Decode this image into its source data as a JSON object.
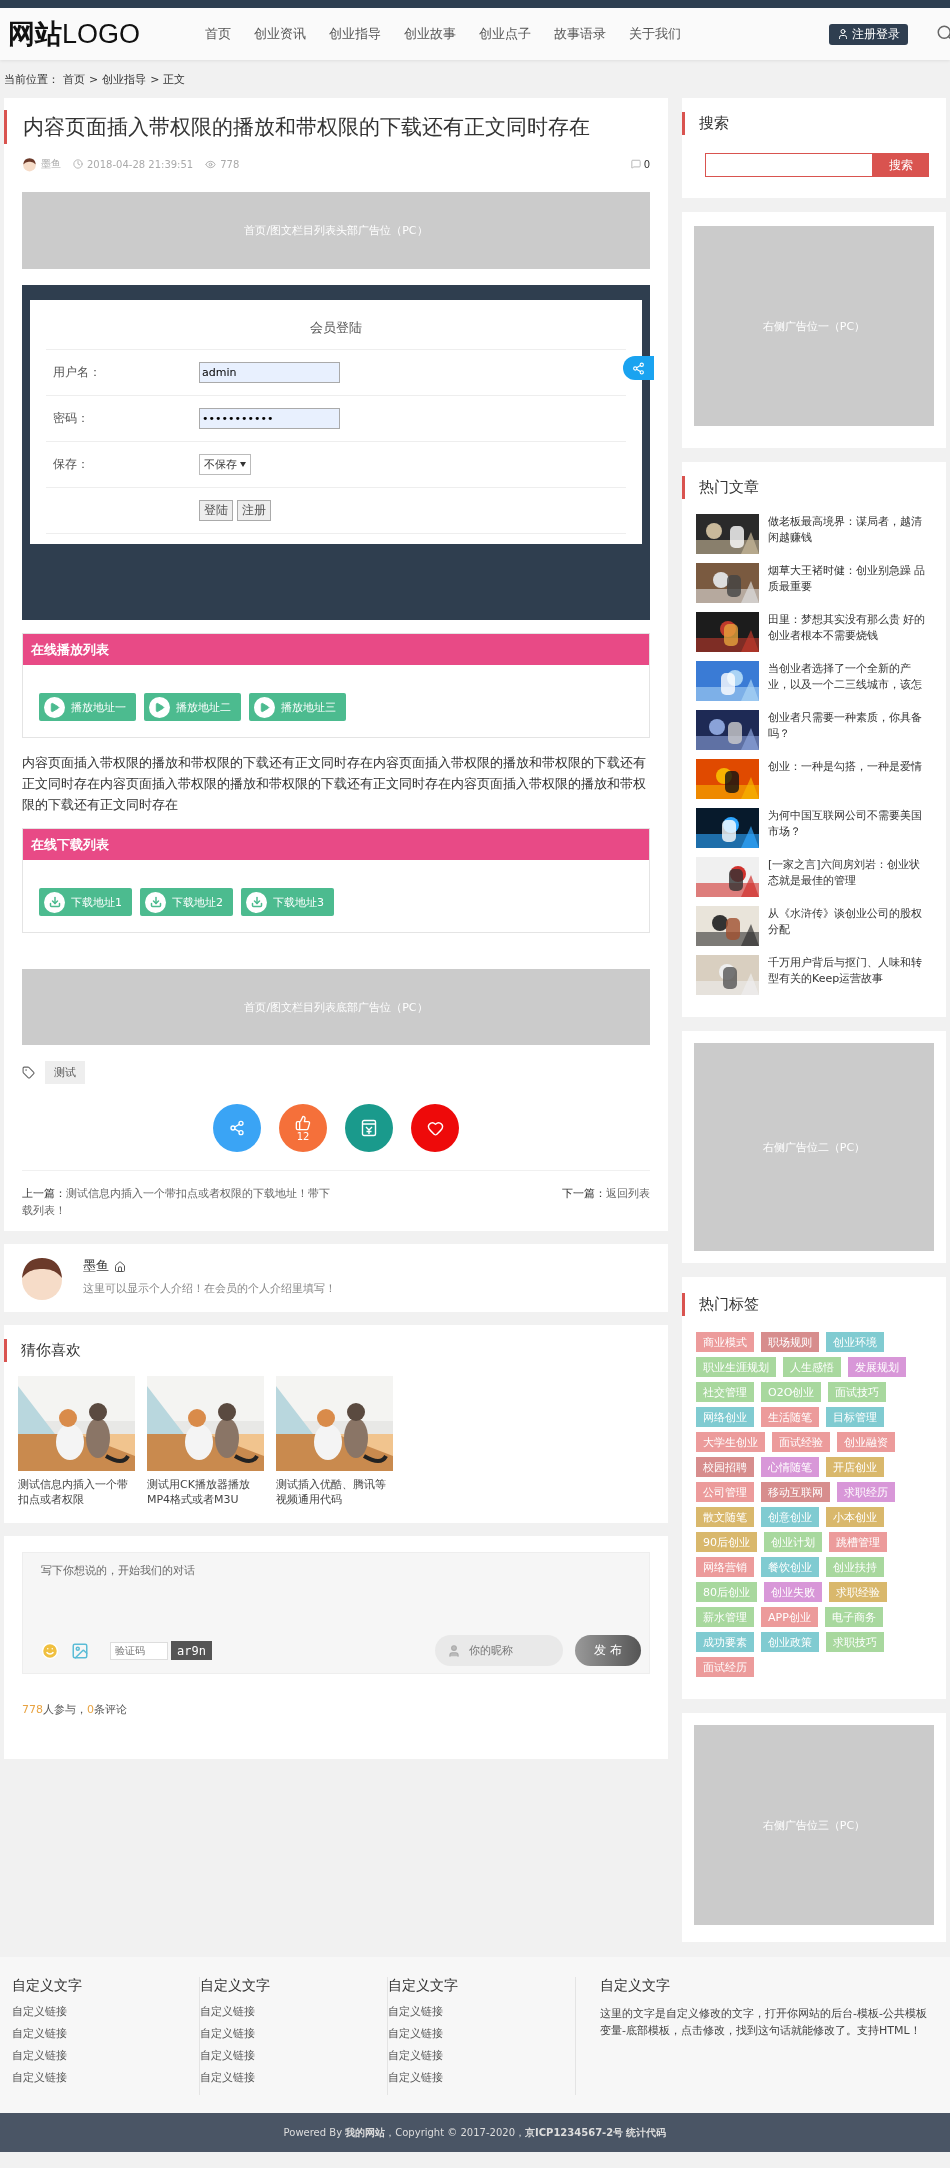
{
  "header": {
    "logo_bold": "网站",
    "logo_light": "LOGO",
    "nav": [
      "首页",
      "创业资讯",
      "创业指导",
      "创业故事",
      "创业点子",
      "故事语录",
      "关于我们"
    ],
    "login_button": "注册登录"
  },
  "breadcrumb": {
    "label": "当前位置：",
    "links": [
      "首页",
      "创业指导",
      "正文"
    ],
    "separators": [
      ">",
      ">"
    ]
  },
  "article": {
    "title": "内容页面插入带权限的播放和带权限的下载还有正文同时存在",
    "author": "墨鱼",
    "date": "2018-04-28 21:39:51",
    "views": "778",
    "comments": "0",
    "ad_top": "首页/图文栏目列表头部广告位（PC）",
    "login_screenshot": {
      "title": "会员登陆",
      "fields": [
        {
          "kind": "text",
          "label": "用户名：",
          "value": "admin"
        },
        {
          "kind": "password",
          "label": "密码：",
          "value": "•••••••••••"
        },
        {
          "kind": "select",
          "label": "保存：",
          "value": "不保存"
        }
      ],
      "buttons": [
        "登陆",
        "注册"
      ]
    },
    "play_list": {
      "title": "在线播放列表",
      "buttons": [
        "播放地址一",
        "播放地址二",
        "播放地址三"
      ]
    },
    "body": "内容页面插入带权限的播放和带权限的下载还有正文同时存在内容页面插入带权限的播放和带权限的下载还有正文同时存在内容页面插入带权限的播放和带权限的下载还有正文同时存在内容页面插入带权限的播放和带权限的下载还有正文同时存在",
    "download_list": {
      "title": "在线下载列表",
      "buttons": [
        "下载地址1",
        "下载地址2",
        "下载地址3"
      ]
    },
    "ad_bottom": "首页/图文栏目列表底部广告位（PC）",
    "tags": [
      "测试"
    ],
    "actions": [
      {
        "kind": "share"
      },
      {
        "kind": "like",
        "count": "12"
      },
      {
        "kind": "reward"
      },
      {
        "kind": "favorite"
      }
    ],
    "prev": {
      "label": "上一篇：",
      "title": "测试信息内插入一个带扣点或者权限的下载地址！带下载列表！"
    },
    "next": {
      "label": "下一篇：",
      "title": "返回列表"
    }
  },
  "author_card": {
    "name": "墨鱼",
    "bio": "这里可以显示个人介绍！在会员的个人介绍里填写！"
  },
  "guess": {
    "title": "猜你喜欢",
    "items": [
      {
        "kind": "picture",
        "title": "测试信息内插入一个带扣点或者权限"
      },
      {
        "kind": "picture",
        "title": "测试用CK播放器播放MP4格式或者M3U"
      },
      {
        "kind": "picture",
        "title": "测试插入优酷、腾讯等视频通用代码"
      }
    ]
  },
  "comment": {
    "placeholder": "写下你想说的，开始我们的对话",
    "captcha_placeholder": "验证码",
    "captcha": "ar9n",
    "nickname_placeholder": "你的昵称",
    "submit": "发 布",
    "participants": "778",
    "participants_label": "人参与，",
    "count": "0",
    "count_label": "条评论"
  },
  "sidebar": {
    "search": {
      "title": "搜索",
      "button": "搜索"
    },
    "ad_1": "右侧广告位一（PC）",
    "hot": {
      "title": "热门文章",
      "items": [
        {
          "kind": "picture",
          "title": "做老板最高境界：谋局者，越清闲越赚钱"
        },
        {
          "kind": "picture",
          "title": "烟草大王褚时健：创业别急躁 品质最重要"
        },
        {
          "kind": "picture",
          "title": "田里：梦想其实没有那么贵 好的创业者根本不需要烧钱"
        },
        {
          "kind": "picture",
          "title": "当创业者选择了一个全新的产业，以及一个二三线城市，该怎"
        },
        {
          "kind": "picture",
          "title": "创业者只需要一种素质，你具备吗？"
        },
        {
          "kind": "picture",
          "title": "创业：一种是勾搭，一种是爱情"
        },
        {
          "kind": "picture",
          "title": "为何中国互联网公司不需要美国市场？"
        },
        {
          "kind": "picture",
          "title": "[一家之言]六间房刘岩：创业状态就是最佳的管理"
        },
        {
          "kind": "picture",
          "title": "从《水浒传》谈创业公司的股权分配"
        },
        {
          "kind": "picture",
          "title": "千万用户背后与抠门、人味和转型有关的Keep运营故事"
        }
      ]
    },
    "ad_2": "右侧广告位二（PC）",
    "tags": {
      "title": "热门标签",
      "items": [
        {
          "label": "商业模式",
          "color": "#ec9b9b"
        },
        {
          "label": "职场规则",
          "color": "#d78d8d"
        },
        {
          "label": "创业环境",
          "color": "#80cbd1"
        },
        {
          "label": "职业生涯规划",
          "color": "#a8d89e"
        },
        {
          "label": "人生感悟",
          "color": "#a8d89e"
        },
        {
          "label": "发展规划",
          "color": "#d897d8"
        },
        {
          "label": "社交管理",
          "color": "#a8d89e"
        },
        {
          "label": "O2O创业",
          "color": "#a8d89e"
        },
        {
          "label": "面试技巧",
          "color": "#a8d89e"
        },
        {
          "label": "网络创业",
          "color": "#80cbd1"
        },
        {
          "label": "生活随笔",
          "color": "#ec9b9b"
        },
        {
          "label": "目标管理",
          "color": "#80cbd1"
        },
        {
          "label": "大学生创业",
          "color": "#ec9b9b"
        },
        {
          "label": "面试经验",
          "color": "#ec9b9b"
        },
        {
          "label": "创业融资",
          "color": "#ec9b9b"
        },
        {
          "label": "校园招聘",
          "color": "#d78d8d"
        },
        {
          "label": "心情随笔",
          "color": "#d897d8"
        },
        {
          "label": "开店创业",
          "color": "#d9b86c"
        },
        {
          "label": "公司管理",
          "color": "#ec9b9b"
        },
        {
          "label": "移动互联网",
          "color": "#d78d8d"
        },
        {
          "label": "求职经历",
          "color": "#d897d8"
        },
        {
          "label": "散文随笔",
          "color": "#d9b86c"
        },
        {
          "label": "创意创业",
          "color": "#80cbd1"
        },
        {
          "label": "小本创业",
          "color": "#d9b86c"
        },
        {
          "label": "90后创业",
          "color": "#d9b86c"
        },
        {
          "label": "创业计划",
          "color": "#a8d89e"
        },
        {
          "label": "跳槽管理",
          "color": "#ec9b9b"
        },
        {
          "label": "网络营销",
          "color": "#ec9b9b"
        },
        {
          "label": "餐饮创业",
          "color": "#80cbd1"
        },
        {
          "label": "创业扶持",
          "color": "#a8d89e"
        },
        {
          "label": "80后创业",
          "color": "#a8d89e"
        },
        {
          "label": "创业失败",
          "color": "#d897d8"
        },
        {
          "label": "求职经验",
          "color": "#d9b86c"
        },
        {
          "label": "薪水管理",
          "color": "#a8d89e"
        },
        {
          "label": "APP创业",
          "color": "#ec9b9b"
        },
        {
          "label": "电子商务",
          "color": "#a8d89e"
        },
        {
          "label": "成功要素",
          "color": "#80cbd1"
        },
        {
          "label": "创业政策",
          "color": "#80cbd1"
        },
        {
          "label": "求职技巧",
          "color": "#a8d89e"
        },
        {
          "label": "面试经历",
          "color": "#ec9b9b"
        }
      ]
    },
    "ad_3": "右侧广告位三（PC）"
  },
  "footer": {
    "columns": [
      {
        "title": "自定义文字",
        "links": [
          "自定义链接",
          "自定义链接",
          "自定义链接",
          "自定义链接"
        ]
      },
      {
        "title": "自定义文字",
        "links": [
          "自定义链接",
          "自定义链接",
          "自定义链接",
          "自定义链接"
        ]
      },
      {
        "title": "自定义文字",
        "links": [
          "自定义链接",
          "自定义链接",
          "自定义链接",
          "自定义链接"
        ]
      }
    ],
    "about": {
      "title": "自定义文字",
      "text": "这里的文字是自定义修改的文字，打开你网站的后台-模板-公共模板变量-底部模板，点击修改，找到这句话就能修改了。支持HTML！"
    },
    "copyright": "Powered By **我的网站**，Copyright © 2017-2020，**京ICP1234567-2号** **统计代码**"
  }
}
